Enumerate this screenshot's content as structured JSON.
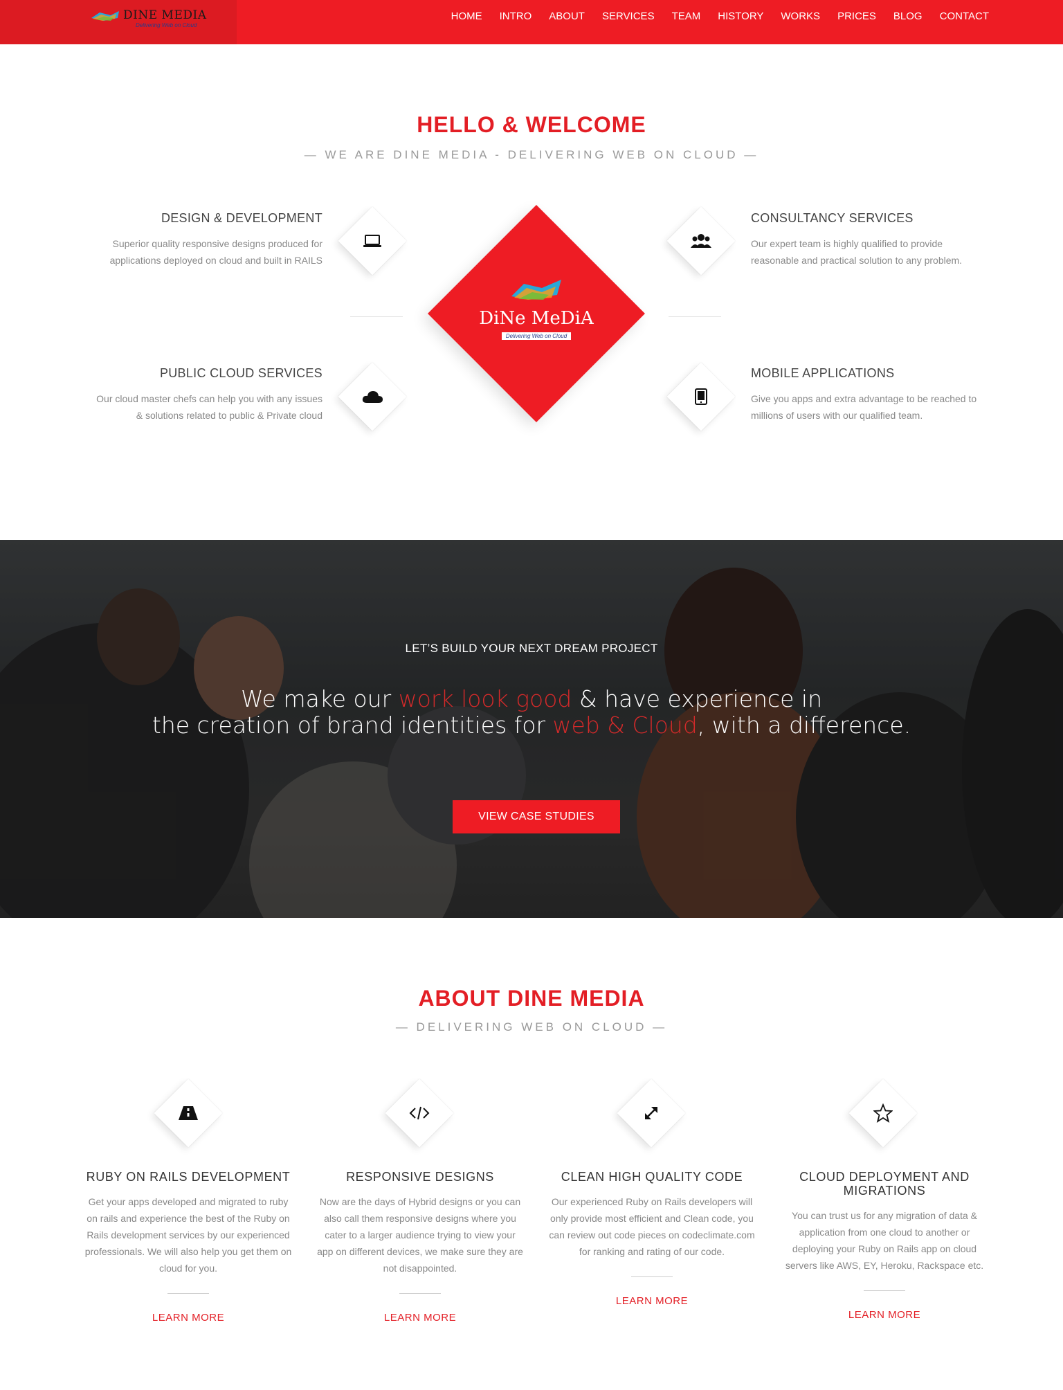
{
  "header": {
    "logo_title": "DINE MEDIA",
    "logo_sub": "Delivering Web on Cloud",
    "nav": [
      "HOME",
      "INTRO",
      "ABOUT",
      "SERVICES",
      "TEAM",
      "HISTORY",
      "WORKS",
      "PRICES",
      "BLOG",
      "CONTACT"
    ]
  },
  "welcome": {
    "title": "HELLO & WELCOME",
    "subtitle": "— WE ARE DINE MEDIA - DELIVERING WEB ON CLOUD —",
    "center_logo_word": "DiNe MeDiA",
    "center_logo_tag": "Delivering Web on Cloud",
    "features": [
      {
        "title": "DESIGN & DEVELOPMENT",
        "text": "Superior quality responsive designs produced for applications deployed on cloud and built in RAILS",
        "icon": "laptop-icon"
      },
      {
        "title": "CONSULTANCY SERVICES",
        "text": "Our expert team is highly qualified to provide reasonable and practical solution to any problem.",
        "icon": "users-icon"
      },
      {
        "title": "PUBLIC CLOUD SERVICES",
        "text": "Our cloud master chefs can help you with any issues & solutions related to public & Private cloud",
        "icon": "cloud-icon"
      },
      {
        "title": "MOBILE APPLICATIONS",
        "text": "Give you apps and extra advantage to be reached to millions of users with our qualified team.",
        "icon": "tablet-icon"
      }
    ]
  },
  "hero": {
    "kicker": "LET’S BUILD YOUR NEXT DREAM PROJECT",
    "line1_a": "We make our ",
    "line1_hl": "work look good",
    "line1_b": " & have experience in",
    "line2_a": "the creation of brand identities for ",
    "line2_hl": "web & Cloud",
    "line2_b": ", with a difference.",
    "button": "VIEW CASE STUDIES"
  },
  "about": {
    "title": "ABOUT DINE MEDIA",
    "subtitle": "— DELIVERING WEB ON CLOUD —",
    "items": [
      {
        "title": "RUBY ON RAILS DEVELOPMENT",
        "text": "Get your apps developed and migrated to ruby on rails and experience the best of the Ruby on Rails development services by our experienced professionals. We will also help you get them on cloud for you.",
        "link": "LEARN MORE",
        "icon": "road-icon"
      },
      {
        "title": "RESPONSIVE DESIGNS",
        "text": "Now are the days of Hybrid designs or you can also call them responsive designs where you cater to a larger audience trying to view your app on different devices, we make sure they are not disappointed.",
        "link": "LEARN MORE",
        "icon": "code-icon"
      },
      {
        "title": "CLEAN HIGH QUALITY CODE",
        "text": "Our experienced Ruby on Rails developers will only provide most efficient and Clean code, you can review out code pieces on codeclimate.com for ranking and rating of our code.",
        "link": "LEARN MORE",
        "icon": "expand-icon"
      },
      {
        "title": "CLOUD DEPLOYMENT AND MIGRATIONS",
        "text": "You can trust us for any migration of data & application from one cloud to another or deploying your Ruby on Rails app on cloud servers like AWS, EY, Heroku, Rackspace etc.",
        "link": "LEARN MORE",
        "icon": "star-icon"
      }
    ]
  },
  "colors": {
    "brand_red": "#ee1c24",
    "accent_red": "#e31e25",
    "text_gray": "#888888"
  }
}
